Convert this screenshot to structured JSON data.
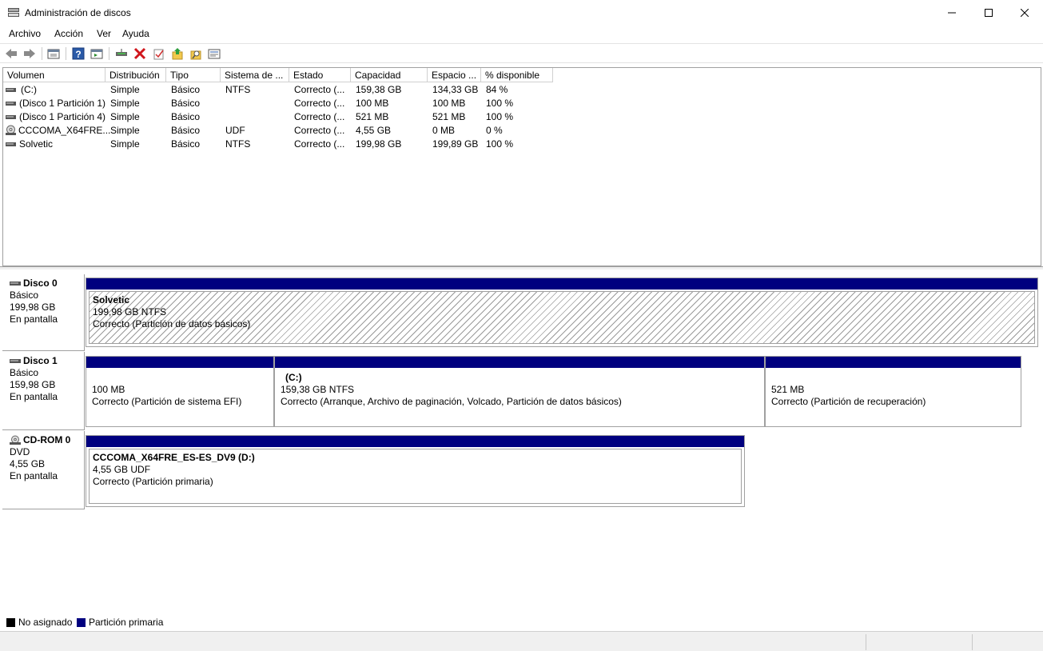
{
  "window": {
    "title": "Administración de discos"
  },
  "menu": [
    "Archivo",
    "Acción",
    "Ver",
    "Ayuda"
  ],
  "toolbar": {
    "icons": [
      "back-icon",
      "forward-icon",
      "properties-view-icon",
      "help-icon",
      "console-view-icon",
      "connect-disk-icon",
      "delete-icon",
      "checklist-icon",
      "export-folder-icon",
      "search-folder-icon",
      "properties-icon"
    ]
  },
  "columns": [
    "Volumen",
    "Distribución",
    "Tipo",
    "Sistema de ...",
    "Estado",
    "Capacidad",
    "Espacio ...",
    "% disponible"
  ],
  "volumes": [
    {
      "name": "(C:)",
      "dist": "Simple",
      "type": "Básico",
      "fs": "NTFS",
      "status": "Correcto (...",
      "cap": "159,38 GB",
      "free": "134,33 GB",
      "pct": "84 %",
      "icon": "drive-icon"
    },
    {
      "name": "(Disco 1 Partición 1)",
      "dist": "Simple",
      "type": "Básico",
      "fs": "",
      "status": "Correcto (...",
      "cap": "100 MB",
      "free": "100 MB",
      "pct": "100 %",
      "icon": "drive-icon"
    },
    {
      "name": "(Disco 1 Partición 4)",
      "dist": "Simple",
      "type": "Básico",
      "fs": "",
      "status": "Correcto (...",
      "cap": "521 MB",
      "free": "521 MB",
      "pct": "100 %",
      "icon": "drive-icon"
    },
    {
      "name": "CCCOMA_X64FRE...",
      "dist": "Simple",
      "type": "Básico",
      "fs": "UDF",
      "status": "Correcto (...",
      "cap": "4,55 GB",
      "free": "0 MB",
      "pct": "0 %",
      "icon": "cdrom-icon"
    },
    {
      "name": "Solvetic",
      "dist": "Simple",
      "type": "Básico",
      "fs": "NTFS",
      "status": "Correcto (...",
      "cap": "199,98 GB",
      "free": "199,89 GB",
      "pct": "100 %",
      "icon": "drive-icon"
    }
  ],
  "disks": [
    {
      "name": "Disco 0",
      "type": "Básico",
      "size": "199,98 GB",
      "state": "En pantalla",
      "partitions": [
        {
          "title": "Solvetic",
          "line1": "199,98 GB NTFS",
          "line2": "Correcto (Partición de datos básicos)"
        }
      ]
    },
    {
      "name": "Disco 1",
      "type": "Básico",
      "size": "159,98 GB",
      "state": "En pantalla",
      "partitions": [
        {
          "title": "",
          "line1": "100 MB",
          "line2": "Correcto (Partición de sistema EFI)"
        },
        {
          "title": "(C:)",
          "line1": "159,38 GB NTFS",
          "line2": "Correcto (Arranque, Archivo de paginación, Volcado, Partición de datos básicos)"
        },
        {
          "title": "",
          "line1": "521 MB",
          "line2": "Correcto (Partición de recuperación)"
        }
      ]
    },
    {
      "name": "CD-ROM 0",
      "type": "DVD",
      "size": "4,55 GB",
      "state": "En pantalla",
      "partitions": [
        {
          "title": "CCCOMA_X64FRE_ES-ES_DV9  (D:)",
          "line1": "4,55 GB UDF",
          "line2": "Correcto (Partición primaria)"
        }
      ]
    }
  ],
  "legend": [
    {
      "label": "No asignado",
      "color": "#000000"
    },
    {
      "label": "Partición primaria",
      "color": "#00007f"
    }
  ]
}
